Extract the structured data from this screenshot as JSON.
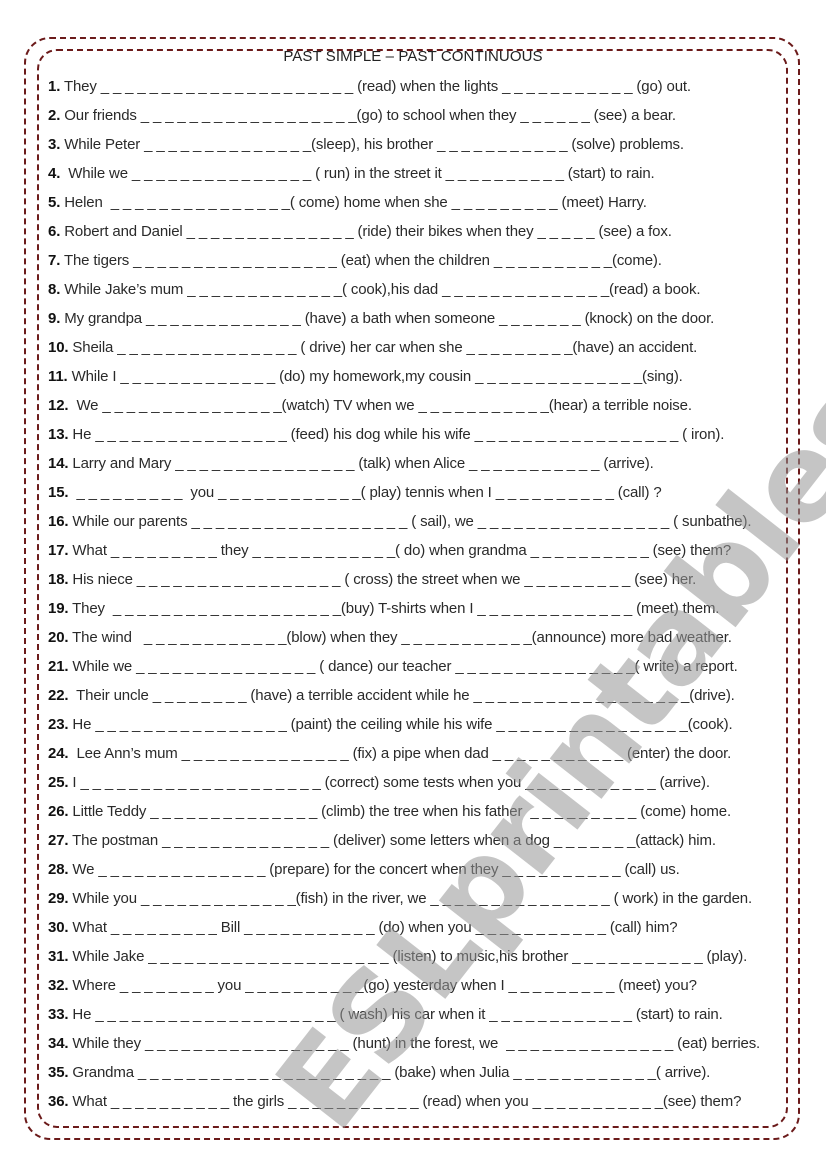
{
  "title": "PAST SIMPLE – PAST CONTINUOUS",
  "watermark": "ESLprintables.com",
  "border_color": "#6b1a1a",
  "exercises": [
    {
      "num": "1.",
      "text": " They _ _ _ _ _ _ _ _ _ _ _ _ _ _ _ _ _ _ _ _ _ (read) when the lights _ _ _ _ _ _ _ _ _ _ _ (go) out."
    },
    {
      "num": "2.",
      "text": " Our friends _ _ _ _ _ _ _ _ _ _ _ _ _ _ _ _ _ _(go) to school when they _ _ _ _ _ _ (see) a bear."
    },
    {
      "num": "3.",
      "text": " While Peter _ _ _ _ _ _ _ _ _ _ _ _ _ _(sleep), his brother _ _ _ _ _ _ _ _ _ _ _ (solve) problems."
    },
    {
      "num": "4.",
      "text": "  While we _ _ _ _ _ _ _ _ _ _ _ _ _ _ _ ( run) in the street it _ _ _ _ _ _ _ _ _ _ (start) to rain."
    },
    {
      "num": "5.",
      "text": " Helen  _ _ _ _ _ _ _ _ _ _ _ _ _ _ _( come) home when she _ _ _ _ _ _ _ _ _ (meet) Harry."
    },
    {
      "num": "6.",
      "text": " Robert and Daniel _ _ _ _ _ _ _ _ _ _ _ _ _ _ (ride) their bikes when they _ _ _ _ _ (see) a fox."
    },
    {
      "num": "7.",
      "text": " The tigers _ _ _ _ _ _ _ _ _ _ _ _ _ _ _ _ _ (eat) when the children _ _ _ _ _ _ _ _ _ _(come)."
    },
    {
      "num": "8.",
      "text": " While Jake’s mum _ _ _ _ _ _ _ _ _ _ _ _ _( cook),his dad _ _ _ _ _ _ _ _ _ _ _ _ _ _(read) a book."
    },
    {
      "num": "9.",
      "text": " My grandpa _ _ _ _ _ _ _ _ _ _ _ _ _ (have) a bath when someone _ _ _ _ _ _ _ (knock) on the door."
    },
    {
      "num": "10.",
      "text": " Sheila _ _ _ _ _ _ _ _ _ _ _ _ _ _ _ ( drive) her car when she _ _ _ _ _ _ _ _ _(have) an accident."
    },
    {
      "num": "11.",
      "text": " While I _ _ _ _ _ _ _ _ _ _ _ _ _ (do) my homework,my cousin _ _ _ _ _ _ _ _ _ _ _ _ _ _(sing)."
    },
    {
      "num": "12.",
      "text": "  We _ _ _ _ _ _ _ _ _ _ _ _ _ _ _(watch) TV when we _ _ _ _ _ _ _ _ _ _ _(hear) a terrible noise."
    },
    {
      "num": "13.",
      "text": " He _ _ _ _ _ _ _ _ _ _ _ _ _ _ _ _ (feed) his dog while his wife _ _ _ _ _ _ _ _ _ _ _ _ _ _ _ _ _ ( iron)."
    },
    {
      "num": "14.",
      "text": " Larry and Mary _ _ _ _ _ _ _ _ _ _ _ _ _ _ _ (talk) when Alice _ _ _ _ _ _ _ _ _ _ _ (arrive)."
    },
    {
      "num": "15.",
      "text": "  _ _ _ _ _ _ _ _ _  you _ _ _ _ _ _ _ _ _ _ _ _( play) tennis when I _ _ _ _ _ _ _ _ _ _ (call) ?"
    },
    {
      "num": "16.",
      "text": " While our parents _ _ _ _ _ _ _ _ _ _ _ _ _ _ _ _ _ _ ( sail), we _ _ _ _ _ _ _ _ _ _ _ _ _ _ _ _ ( sunbathe)."
    },
    {
      "num": "17.",
      "text": " What _ _ _ _ _ _ _ _ _ they _ _ _ _ _ _ _ _ _ _ _ _( do) when grandma _ _ _ _ _ _ _ _ _ _ (see) them?"
    },
    {
      "num": "18.",
      "text": " His niece _ _ _ _ _ _ _ _ _ _ _ _ _ _ _ _ _ ( cross) the street when we _ _ _ _ _ _ _ _ _ (see) her."
    },
    {
      "num": "19.",
      "text": " They  _ _ _ _ _ _ _ _ _ _ _ _ _ _ _ _ _ _ _(buy) T-shirts when I _ _ _ _ _ _ _ _ _ _ _ _ _ (meet) them."
    },
    {
      "num": "20.",
      "text": " The wind   _ _ _ _ _ _ _ _ _ _ _ _(blow) when they _ _ _ _ _ _ _ _ _ _ _(announce) more bad weather."
    },
    {
      "num": "21.",
      "text": " While we _ _ _ _ _ _ _ _ _ _ _ _ _ _ _ ( dance) our teacher _ _ _ _ _ _ _ _ _ _ _ _ _ _ _( write) a report."
    },
    {
      "num": "22.",
      "text": "  Their uncle _ _ _ _ _ _ _ _ (have) a terrible accident while he _ _ _ _ _ _ _ _ _ _ _ _ _ _ _ _ _ _(drive)."
    },
    {
      "num": "23.",
      "text": " He _ _ _ _ _ _ _ _ _ _ _ _ _ _ _ _ (paint) the ceiling while his wife _ _ _ _ _ _ _ _ _ _ _ _ _ _ _ _(cook)."
    },
    {
      "num": "24.",
      "text": "  Lee Ann’s mum _ _ _ _ _ _ _ _ _ _ _ _ _ _ (fix) a pipe when dad _ _ _ _ _ _ _ _ _ _ _ (enter) the door."
    },
    {
      "num": "25.",
      "text": " I _ _ _ _ _ _ _ _ _ _ _ _ _ _ _ _ _ _ _ _ (correct) some tests when you _ _ _ _ _ _ _ _ _ _ _ (arrive)."
    },
    {
      "num": "26.",
      "text": " Little Teddy _ _ _ _ _ _ _ _ _ _ _ _ _ _ (climb) the tree when his father  _ _ _ _ _ _ _ _ _ (come) home."
    },
    {
      "num": "27.",
      "text": " The postman _ _ _ _ _ _ _ _ _ _ _ _ _ _ (deliver) some letters when a dog _ _ _ _ _ _ _(attack) him."
    },
    {
      "num": "28.",
      "text": " We _ _ _ _ _ _ _ _ _ _ _ _ _ _ (prepare) for the concert when they _ _ _ _ _ _ _ _ _ _ (call) us."
    },
    {
      "num": "29.",
      "text": " While you _ _ _ _ _ _ _ _ _ _ _ _ _(fish) in the river, we _ _ _ _ _ _ _ _ _ _ _ _ _ _ _ ( work) in the garden."
    },
    {
      "num": "30.",
      "text": " What _ _ _ _ _ _ _ _ _ Bill _ _ _ _ _ _ _ _ _ _ _ (do) when you _ _ _ _ _ _ _ _ _ _ _ (call) him?"
    },
    {
      "num": "31.",
      "text": " While Jake _ _ _ _ _ _ _ _ _ _ _ _ _ _ _ _ _ _ _ _ (listen) to music,his brother _ _ _ _ _ _ _ _ _ _ _ (play)."
    },
    {
      "num": "32.",
      "text": " Where _ _ _ _ _ _ _ _ you _ _ _ _ _ _ _ _ _ _(go) yesterday when I _ _ _ _ _ _ _ _ _ (meet) you?"
    },
    {
      "num": "33.",
      "text": " He _ _ _ _ _ _ _ _ _ _ _ _ _ _ _ _ _ _ _ _ ( wash) his car when it _ _ _ _ _ _ _ _ _ _ _ _ (start) to rain."
    },
    {
      "num": "34.",
      "text": " While they _ _ _ _ _ _ _ _ _ _ _ _ _ _ _ _ _ (hunt) in the forest, we  _ _ _ _ _ _ _ _ _ _ _ _ _ _ (eat) berries."
    },
    {
      "num": "35.",
      "text": " Grandma _ _ _ _ _ _ _ _ _ _ _ _ _ _ _ _ _ _ _ _ _ (bake) when Julia _ _ _ _ _ _ _ _ _ _ _ _( arrive)."
    },
    {
      "num": "36.",
      "text": " What _ _ _ _ _ _ _ _ _ _ the girls _ _ _ _ _ _ _ _ _ _ _ (read) when you _ _ _ _ _ _ _ _ _ _ _(see) them?"
    }
  ]
}
